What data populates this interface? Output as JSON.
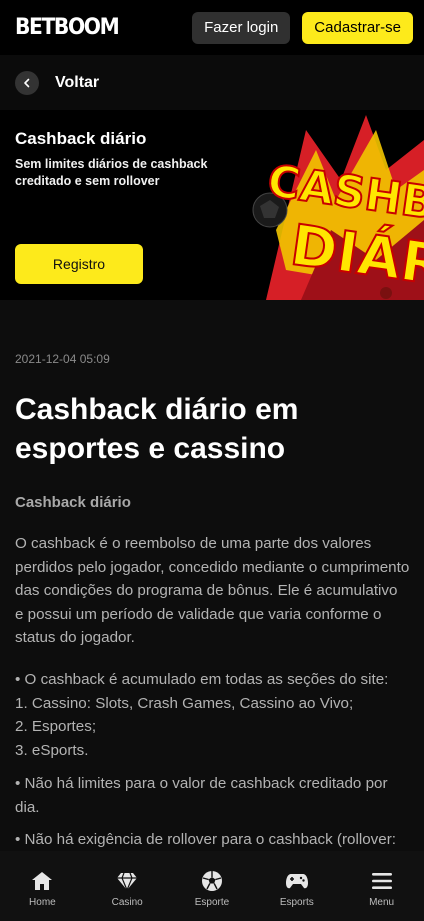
{
  "header": {
    "logo": "BETBOOM",
    "login_label": "Fazer login",
    "signup_label": "Cadastrar-se"
  },
  "back": {
    "label": "Voltar"
  },
  "banner": {
    "title": "Cashback diário",
    "subtitle": "Sem limites diários de cashback creditado e sem rollover",
    "button_label": "Registro",
    "art_text_top": "CASHBACK",
    "art_text_bottom": "DIÁRIO"
  },
  "article": {
    "date": "2021-12-04 05:09",
    "title": "Cashback diário em esportes e cassino",
    "subtitle": "Cashback diário",
    "paragraph": "O cashback é o reembolso de uma parte dos valores perdidos pelo jogador, concedido mediante o cumprimento das condições do programa de bônus. Ele é acumulativo e possui um período de validade que varia conforme o status do jogador.",
    "list_intro": "•  O cashback é acumulado em todas as seções do site:",
    "list_items": [
      "1. Cassino: Slots, Crash Games, Cassino ao Vivo;",
      "2. Esportes;",
      "3. eSports."
    ],
    "bullet_2": "•  Não há limites para o valor de cashback creditado por dia.",
    "bullet_3": "•  Não há exigência de rollover para o cashback (rollover:"
  },
  "bottom_nav": [
    {
      "label": "Home",
      "icon": "home-icon"
    },
    {
      "label": "Casino",
      "icon": "diamond-icon"
    },
    {
      "label": "Esporte",
      "icon": "soccer-ball-icon"
    },
    {
      "label": "Esports",
      "icon": "gamepad-icon"
    },
    {
      "label": "Menu",
      "icon": "hamburger-menu-icon"
    }
  ],
  "colors": {
    "accent": "#fdea1b",
    "background": "#0d0d0d",
    "header": "#000000"
  }
}
